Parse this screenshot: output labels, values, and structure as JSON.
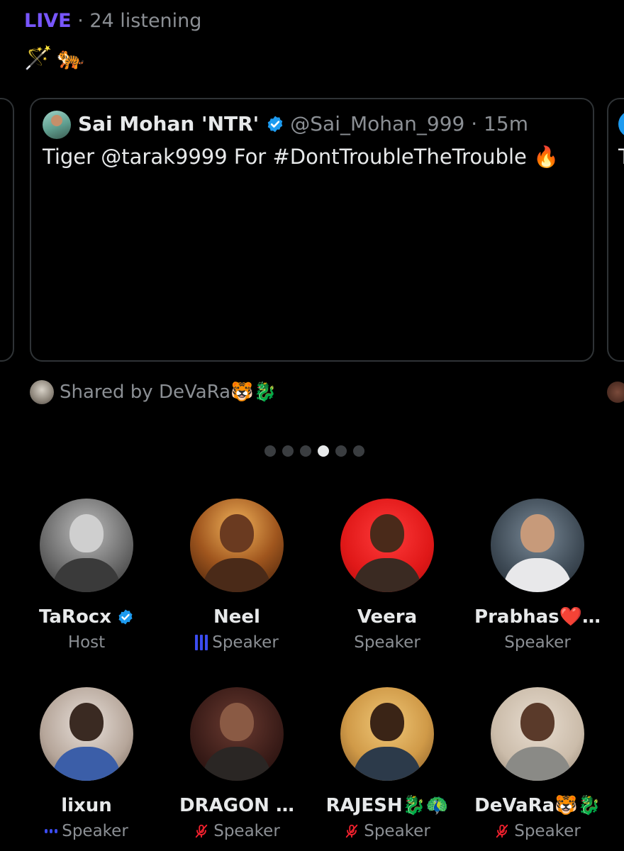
{
  "header": {
    "live_label": "LIVE",
    "listening_text": "· 24 listening"
  },
  "emojis": "🪄🐅",
  "card": {
    "author_name": "Sai Mohan 'NTR'",
    "handle_time": "@Sai_Mohan_999 · 15m",
    "text": "Tiger @tarak9999 For #DontTroubleTheTrouble 🔥",
    "next_card_char": "T"
  },
  "shared_by": "Shared by DeVaRa🐯🐉",
  "pagination": {
    "total": 6,
    "active_index": 3
  },
  "colors": {
    "live": "#7856ff",
    "verified": "#1d9bf0",
    "speaking": "#3b4cf0",
    "muted": "#f4212e"
  },
  "participants": [
    {
      "name": "TaRocx",
      "verified": true,
      "role": "Host",
      "status": "none"
    },
    {
      "name": "Neel",
      "verified": false,
      "role": "Speaker",
      "status": "speaking-bars"
    },
    {
      "name": "Veera",
      "verified": false,
      "role": "Speaker",
      "status": "none"
    },
    {
      "name": "Prabhas❤️…",
      "verified": false,
      "role": "Speaker",
      "status": "none"
    },
    {
      "name": "lixun",
      "verified": false,
      "role": "Speaker",
      "status": "speaking-dots"
    },
    {
      "name": "DRAGON …",
      "verified": false,
      "role": "Speaker",
      "status": "muted"
    },
    {
      "name": "RAJESH🐉🦚",
      "verified": false,
      "role": "Speaker",
      "status": "muted"
    },
    {
      "name": "DeVaRa🐯🐉",
      "verified": false,
      "role": "Speaker",
      "status": "muted"
    }
  ]
}
